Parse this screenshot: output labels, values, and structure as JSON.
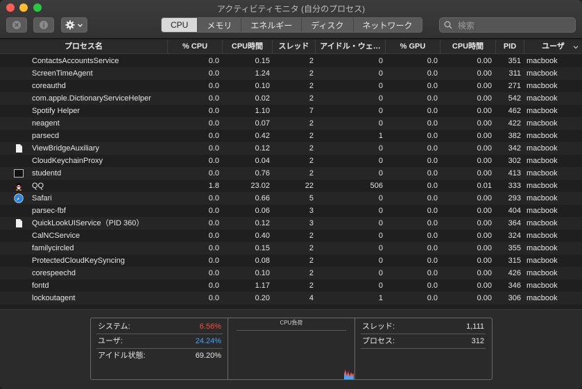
{
  "window": {
    "title": "アクティビティモニタ (自分のプロセス)"
  },
  "toolbar": {
    "tabs": [
      "CPU",
      "メモリ",
      "エネルギー",
      "ディスク",
      "ネットワーク"
    ],
    "active_tab": "CPU",
    "search_placeholder": "検索"
  },
  "table": {
    "columns": [
      "プロセス名",
      "% CPU",
      "CPU時間",
      "スレッド",
      "アイドル・ウェ…",
      "% GPU",
      "CPU時間",
      "PID",
      "ユーザ"
    ],
    "rows": [
      {
        "name": "ContactsAccountsService",
        "cpu": "0.0",
        "cpu_time": "0.15",
        "threads": "2",
        "idle_wake": "0",
        "gpu": "0.0",
        "gpu_time": "0.00",
        "pid": "351",
        "user": "macbook",
        "icon": ""
      },
      {
        "name": "ScreenTimeAgent",
        "cpu": "0.0",
        "cpu_time": "1.24",
        "threads": "2",
        "idle_wake": "0",
        "gpu": "0.0",
        "gpu_time": "0.00",
        "pid": "311",
        "user": "macbook",
        "icon": ""
      },
      {
        "name": "coreauthd",
        "cpu": "0.0",
        "cpu_time": "0.10",
        "threads": "2",
        "idle_wake": "0",
        "gpu": "0.0",
        "gpu_time": "0.00",
        "pid": "271",
        "user": "macbook",
        "icon": ""
      },
      {
        "name": "com.apple.DictionaryServiceHelper",
        "cpu": "0.0",
        "cpu_time": "0.02",
        "threads": "2",
        "idle_wake": "0",
        "gpu": "0.0",
        "gpu_time": "0.00",
        "pid": "542",
        "user": "macbook",
        "icon": ""
      },
      {
        "name": "Spotify Helper",
        "cpu": "0.0",
        "cpu_time": "1.10",
        "threads": "7",
        "idle_wake": "0",
        "gpu": "0.0",
        "gpu_time": "0.00",
        "pid": "462",
        "user": "macbook",
        "icon": ""
      },
      {
        "name": "neagent",
        "cpu": "0.0",
        "cpu_time": "0.07",
        "threads": "2",
        "idle_wake": "0",
        "gpu": "0.0",
        "gpu_time": "0.00",
        "pid": "422",
        "user": "macbook",
        "icon": ""
      },
      {
        "name": "parsecd",
        "cpu": "0.0",
        "cpu_time": "0.42",
        "threads": "2",
        "idle_wake": "1",
        "gpu": "0.0",
        "gpu_time": "0.00",
        "pid": "382",
        "user": "macbook",
        "icon": ""
      },
      {
        "name": "ViewBridgeAuxiliary",
        "cpu": "0.0",
        "cpu_time": "0.12",
        "threads": "2",
        "idle_wake": "0",
        "gpu": "0.0",
        "gpu_time": "0.00",
        "pid": "342",
        "user": "macbook",
        "icon": "document"
      },
      {
        "name": "CloudKeychainProxy",
        "cpu": "0.0",
        "cpu_time": "0.04",
        "threads": "2",
        "idle_wake": "0",
        "gpu": "0.0",
        "gpu_time": "0.00",
        "pid": "302",
        "user": "macbook",
        "icon": ""
      },
      {
        "name": "studentd",
        "cpu": "0.0",
        "cpu_time": "0.76",
        "threads": "2",
        "idle_wake": "0",
        "gpu": "0.0",
        "gpu_time": "0.00",
        "pid": "413",
        "user": "macbook",
        "icon": "window"
      },
      {
        "name": "QQ",
        "cpu": "1.8",
        "cpu_time": "23.02",
        "threads": "22",
        "idle_wake": "506",
        "gpu": "0.0",
        "gpu_time": "0.01",
        "pid": "333",
        "user": "macbook",
        "icon": "penguin"
      },
      {
        "name": "Safari",
        "cpu": "0.0",
        "cpu_time": "0.66",
        "threads": "5",
        "idle_wake": "0",
        "gpu": "0.0",
        "gpu_time": "0.00",
        "pid": "293",
        "user": "macbook",
        "icon": "compass"
      },
      {
        "name": "parsec-fbf",
        "cpu": "0.0",
        "cpu_time": "0.06",
        "threads": "3",
        "idle_wake": "0",
        "gpu": "0.0",
        "gpu_time": "0.00",
        "pid": "404",
        "user": "macbook",
        "icon": ""
      },
      {
        "name": "QuickLookUIService（PID 360）",
        "cpu": "0.0",
        "cpu_time": "0.12",
        "threads": "3",
        "idle_wake": "0",
        "gpu": "0.0",
        "gpu_time": "0.00",
        "pid": "364",
        "user": "macbook",
        "icon": "document"
      },
      {
        "name": "CalNCService",
        "cpu": "0.0",
        "cpu_time": "0.40",
        "threads": "2",
        "idle_wake": "0",
        "gpu": "0.0",
        "gpu_time": "0.00",
        "pid": "324",
        "user": "macbook",
        "icon": ""
      },
      {
        "name": "familycircled",
        "cpu": "0.0",
        "cpu_time": "0.15",
        "threads": "2",
        "idle_wake": "0",
        "gpu": "0.0",
        "gpu_time": "0.00",
        "pid": "355",
        "user": "macbook",
        "icon": ""
      },
      {
        "name": "ProtectedCloudKeySyncing",
        "cpu": "0.0",
        "cpu_time": "0.08",
        "threads": "2",
        "idle_wake": "0",
        "gpu": "0.0",
        "gpu_time": "0.00",
        "pid": "315",
        "user": "macbook",
        "icon": ""
      },
      {
        "name": "corespeechd",
        "cpu": "0.0",
        "cpu_time": "0.10",
        "threads": "2",
        "idle_wake": "0",
        "gpu": "0.0",
        "gpu_time": "0.00",
        "pid": "426",
        "user": "macbook",
        "icon": ""
      },
      {
        "name": "fontd",
        "cpu": "0.0",
        "cpu_time": "1.17",
        "threads": "2",
        "idle_wake": "0",
        "gpu": "0.0",
        "gpu_time": "0.00",
        "pid": "346",
        "user": "macbook",
        "icon": ""
      },
      {
        "name": "lockoutagent",
        "cpu": "0.0",
        "cpu_time": "0.20",
        "threads": "4",
        "idle_wake": "1",
        "gpu": "0.0",
        "gpu_time": "0.00",
        "pid": "306",
        "user": "macbook",
        "icon": ""
      }
    ]
  },
  "summary": {
    "system_label": "システム:",
    "system_value": "6.56%",
    "user_label": "ユーザ:",
    "user_value": "24.24%",
    "idle_label": "アイドル状態:",
    "idle_value": "69.20%",
    "graph_title": "CPU負荷",
    "threads_label": "スレッド:",
    "threads_value": "1,111",
    "processes_label": "プロセス:",
    "processes_value": "312",
    "colors": {
      "system": "#ff4b3e",
      "user": "#3ea6ff"
    }
  }
}
